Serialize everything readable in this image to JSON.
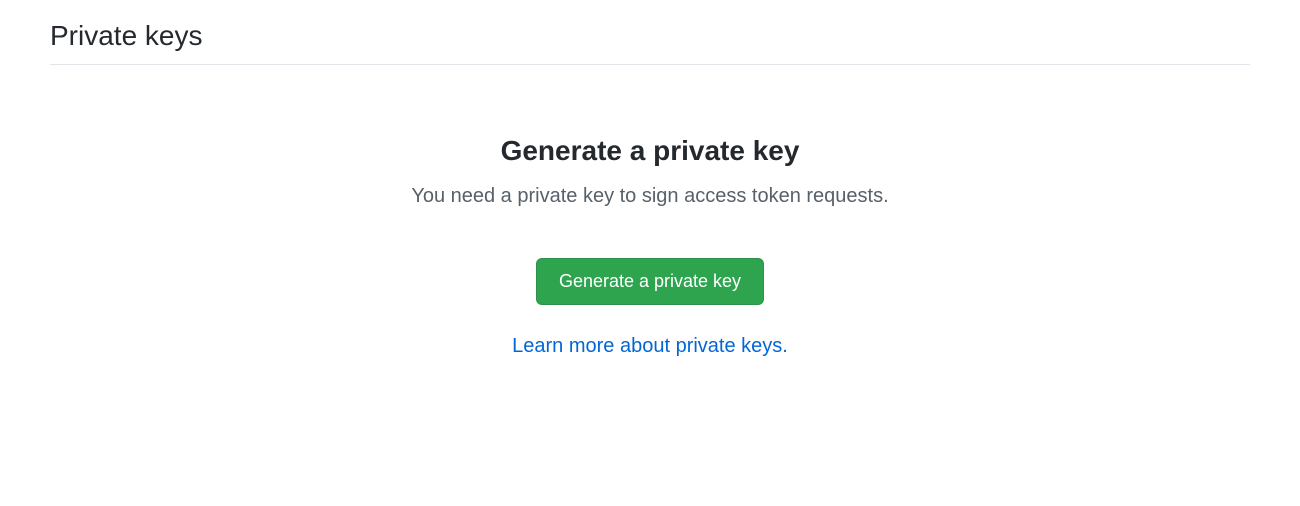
{
  "section": {
    "title": "Private keys"
  },
  "content": {
    "heading": "Generate a private key",
    "description": "You need a private key to sign access token requests.",
    "button_label": "Generate a private key",
    "link_text": "Learn more about private keys",
    "link_suffix": "."
  }
}
